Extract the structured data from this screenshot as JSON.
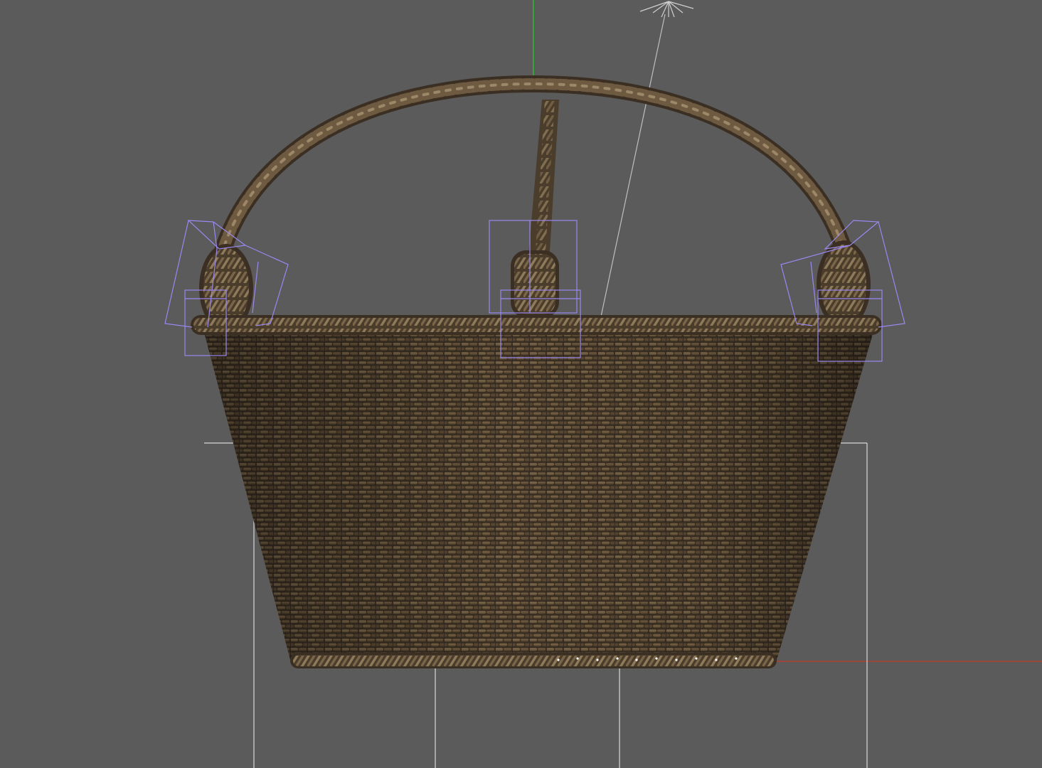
{
  "viewport": {
    "background_color": "#5b5b5b",
    "axis_colors": {
      "x_axis": "#b04030",
      "y_axis": "#2fb82f",
      "guide_lines": "#d8d8d8",
      "light_helper": "#bfbfbf"
    },
    "selection_bracket_color": "#9a88f0",
    "object": {
      "kind": "wicker-basket",
      "material_colors": {
        "wicker_dark": "#3a2f22",
        "wicker_mid": "#5e4d38",
        "wicker_light": "#8a7558",
        "rope_highlight": "#9c8768"
      }
    },
    "helpers": {
      "light_icon": "omni-light-icon",
      "selection_brackets": "selection-bracket-icon"
    }
  }
}
